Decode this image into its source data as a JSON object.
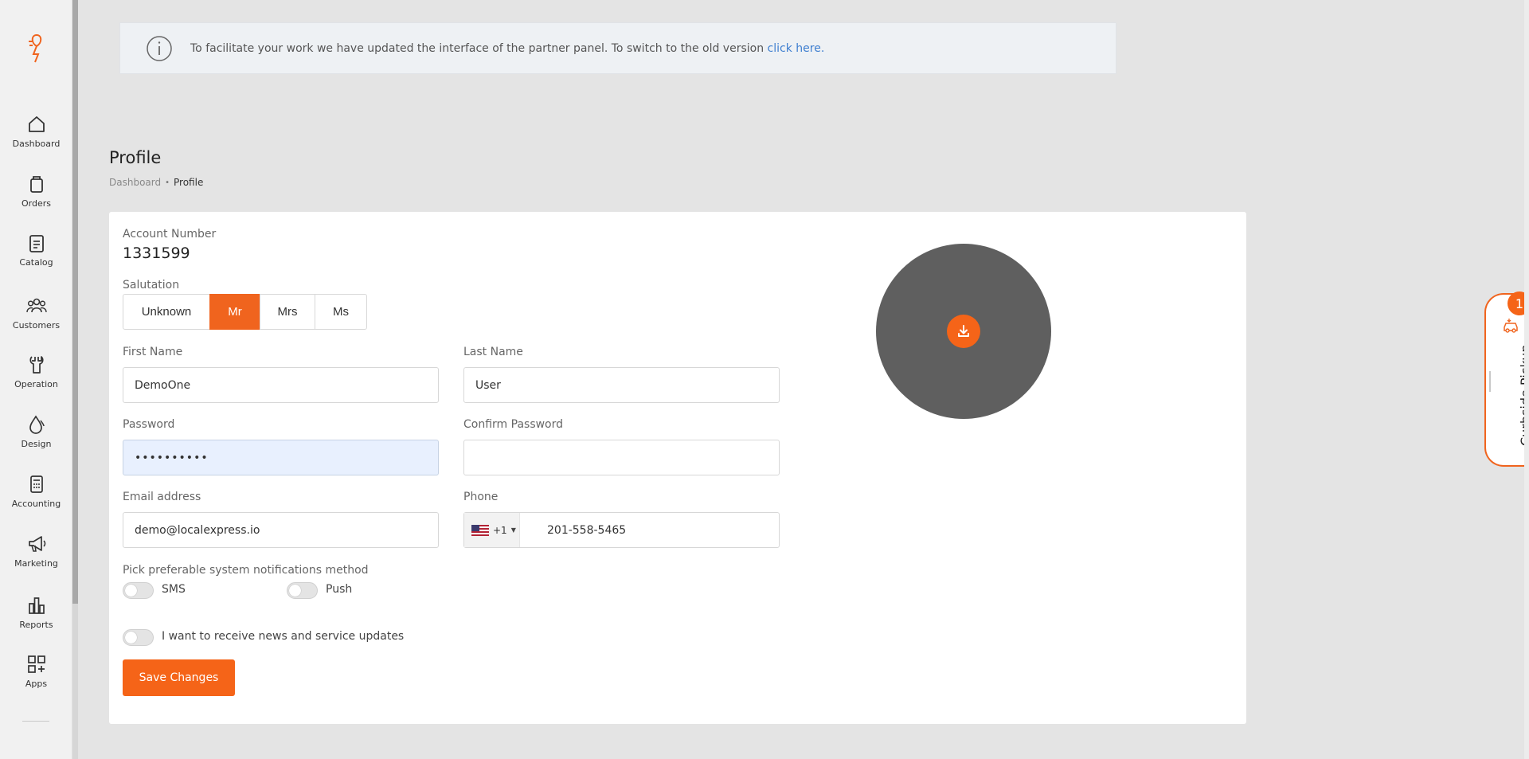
{
  "sidebar": {
    "items": [
      {
        "label": "Dashboard"
      },
      {
        "label": "Orders"
      },
      {
        "label": "Catalog"
      },
      {
        "label": "Customers"
      },
      {
        "label": "Operation"
      },
      {
        "label": "Design"
      },
      {
        "label": "Accounting"
      },
      {
        "label": "Marketing"
      },
      {
        "label": "Reports"
      },
      {
        "label": "Apps"
      }
    ]
  },
  "notice": {
    "text": "To facilitate your work we have updated the interface of the partner panel. To switch to the old version ",
    "link": "click here."
  },
  "page": {
    "title": "Profile",
    "breadcrumb": {
      "home": "Dashboard",
      "separator": "•",
      "current": "Profile"
    }
  },
  "form": {
    "account_label": "Account Number",
    "account_number": "1331599",
    "salutation_label": "Salutation",
    "salutations": [
      "Unknown",
      "Mr",
      "Mrs",
      "Ms"
    ],
    "salutation_selected": "Mr",
    "first_name_label": "First Name",
    "first_name": "DemoOne",
    "last_name_label": "Last Name",
    "last_name": "User",
    "password_label": "Password",
    "password_mask": "••••••••••",
    "confirm_password_label": "Confirm Password",
    "email_label": "Email address",
    "email": "demo@localexpress.io",
    "phone_label": "Phone",
    "phone_country_code": "+1",
    "phone_number": "201-558-5465",
    "notify_label": "Pick preferable system notifications method",
    "sms_label": "SMS",
    "push_label": "Push",
    "news_label": "I want to receive news and service updates",
    "save_label": "Save Changes"
  },
  "curbside": {
    "label": "Curbside Pickup",
    "count": "1"
  },
  "colors": {
    "accent": "#f56418",
    "link": "#3f7fd0",
    "avatar_bg": "#5f5f5f"
  }
}
